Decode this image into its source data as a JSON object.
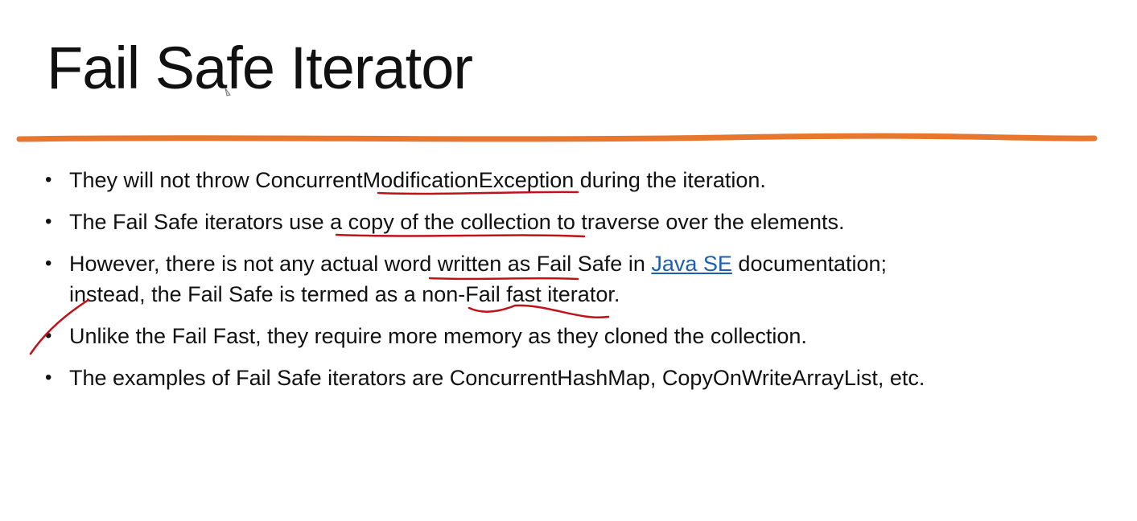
{
  "title": "Fail Safe Iterator",
  "accent_color": "#e8762c",
  "ink_color": "#c0121a",
  "link_color": "#1a5fb4",
  "bullets": [
    {
      "text": "They will not throw ConcurrentModificationException during the iteration."
    },
    {
      "text": "The Fail Safe iterators use a copy of the collection to traverse over the elements."
    },
    {
      "before": "However, there is not any actual word written as Fail Safe in ",
      "link": "Java SE",
      "after": " documentation;",
      "line2": "instead, the Fail Safe is termed as a non-Fail fast iterator."
    },
    {
      "text": "Unlike the Fail Fast, they require more memory as they cloned the collection."
    },
    {
      "text": "The examples of Fail Safe iterators are ConcurrentHashMap, CopyOnWriteArrayList, etc."
    }
  ]
}
